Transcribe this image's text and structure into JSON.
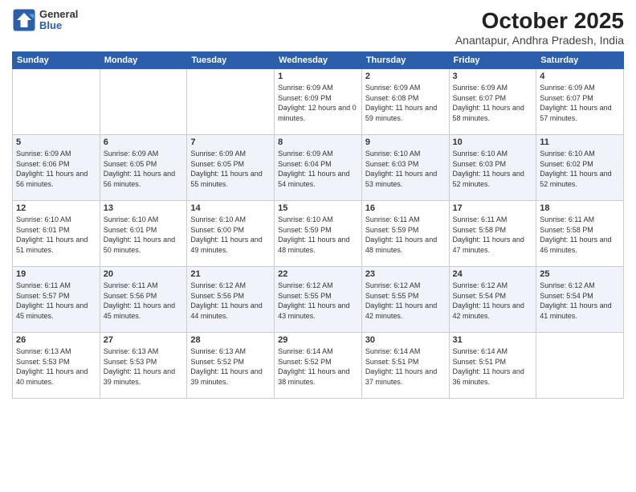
{
  "header": {
    "logo_general": "General",
    "logo_blue": "Blue",
    "title": "October 2025",
    "location": "Anantapur, Andhra Pradesh, India"
  },
  "weekdays": [
    "Sunday",
    "Monday",
    "Tuesday",
    "Wednesday",
    "Thursday",
    "Friday",
    "Saturday"
  ],
  "weeks": [
    [
      null,
      null,
      null,
      {
        "day": 1,
        "sunrise": "6:09 AM",
        "sunset": "6:09 PM",
        "daylight": "12 hours and 0 minutes."
      },
      {
        "day": 2,
        "sunrise": "6:09 AM",
        "sunset": "6:08 PM",
        "daylight": "11 hours and 59 minutes."
      },
      {
        "day": 3,
        "sunrise": "6:09 AM",
        "sunset": "6:07 PM",
        "daylight": "11 hours and 58 minutes."
      },
      {
        "day": 4,
        "sunrise": "6:09 AM",
        "sunset": "6:07 PM",
        "daylight": "11 hours and 57 minutes."
      }
    ],
    [
      {
        "day": 5,
        "sunrise": "6:09 AM",
        "sunset": "6:06 PM",
        "daylight": "11 hours and 56 minutes."
      },
      {
        "day": 6,
        "sunrise": "6:09 AM",
        "sunset": "6:05 PM",
        "daylight": "11 hours and 56 minutes."
      },
      {
        "day": 7,
        "sunrise": "6:09 AM",
        "sunset": "6:05 PM",
        "daylight": "11 hours and 55 minutes."
      },
      {
        "day": 8,
        "sunrise": "6:09 AM",
        "sunset": "6:04 PM",
        "daylight": "11 hours and 54 minutes."
      },
      {
        "day": 9,
        "sunrise": "6:10 AM",
        "sunset": "6:03 PM",
        "daylight": "11 hours and 53 minutes."
      },
      {
        "day": 10,
        "sunrise": "6:10 AM",
        "sunset": "6:03 PM",
        "daylight": "11 hours and 52 minutes."
      },
      {
        "day": 11,
        "sunrise": "6:10 AM",
        "sunset": "6:02 PM",
        "daylight": "11 hours and 52 minutes."
      }
    ],
    [
      {
        "day": 12,
        "sunrise": "6:10 AM",
        "sunset": "6:01 PM",
        "daylight": "11 hours and 51 minutes."
      },
      {
        "day": 13,
        "sunrise": "6:10 AM",
        "sunset": "6:01 PM",
        "daylight": "11 hours and 50 minutes."
      },
      {
        "day": 14,
        "sunrise": "6:10 AM",
        "sunset": "6:00 PM",
        "daylight": "11 hours and 49 minutes."
      },
      {
        "day": 15,
        "sunrise": "6:10 AM",
        "sunset": "5:59 PM",
        "daylight": "11 hours and 48 minutes."
      },
      {
        "day": 16,
        "sunrise": "6:11 AM",
        "sunset": "5:59 PM",
        "daylight": "11 hours and 48 minutes."
      },
      {
        "day": 17,
        "sunrise": "6:11 AM",
        "sunset": "5:58 PM",
        "daylight": "11 hours and 47 minutes."
      },
      {
        "day": 18,
        "sunrise": "6:11 AM",
        "sunset": "5:58 PM",
        "daylight": "11 hours and 46 minutes."
      }
    ],
    [
      {
        "day": 19,
        "sunrise": "6:11 AM",
        "sunset": "5:57 PM",
        "daylight": "11 hours and 45 minutes."
      },
      {
        "day": 20,
        "sunrise": "6:11 AM",
        "sunset": "5:56 PM",
        "daylight": "11 hours and 45 minutes."
      },
      {
        "day": 21,
        "sunrise": "6:12 AM",
        "sunset": "5:56 PM",
        "daylight": "11 hours and 44 minutes."
      },
      {
        "day": 22,
        "sunrise": "6:12 AM",
        "sunset": "5:55 PM",
        "daylight": "11 hours and 43 minutes."
      },
      {
        "day": 23,
        "sunrise": "6:12 AM",
        "sunset": "5:55 PM",
        "daylight": "11 hours and 42 minutes."
      },
      {
        "day": 24,
        "sunrise": "6:12 AM",
        "sunset": "5:54 PM",
        "daylight": "11 hours and 42 minutes."
      },
      {
        "day": 25,
        "sunrise": "6:12 AM",
        "sunset": "5:54 PM",
        "daylight": "11 hours and 41 minutes."
      }
    ],
    [
      {
        "day": 26,
        "sunrise": "6:13 AM",
        "sunset": "5:53 PM",
        "daylight": "11 hours and 40 minutes."
      },
      {
        "day": 27,
        "sunrise": "6:13 AM",
        "sunset": "5:53 PM",
        "daylight": "11 hours and 39 minutes."
      },
      {
        "day": 28,
        "sunrise": "6:13 AM",
        "sunset": "5:52 PM",
        "daylight": "11 hours and 39 minutes."
      },
      {
        "day": 29,
        "sunrise": "6:14 AM",
        "sunset": "5:52 PM",
        "daylight": "11 hours and 38 minutes."
      },
      {
        "day": 30,
        "sunrise": "6:14 AM",
        "sunset": "5:51 PM",
        "daylight": "11 hours and 37 minutes."
      },
      {
        "day": 31,
        "sunrise": "6:14 AM",
        "sunset": "5:51 PM",
        "daylight": "11 hours and 36 minutes."
      },
      null
    ]
  ]
}
